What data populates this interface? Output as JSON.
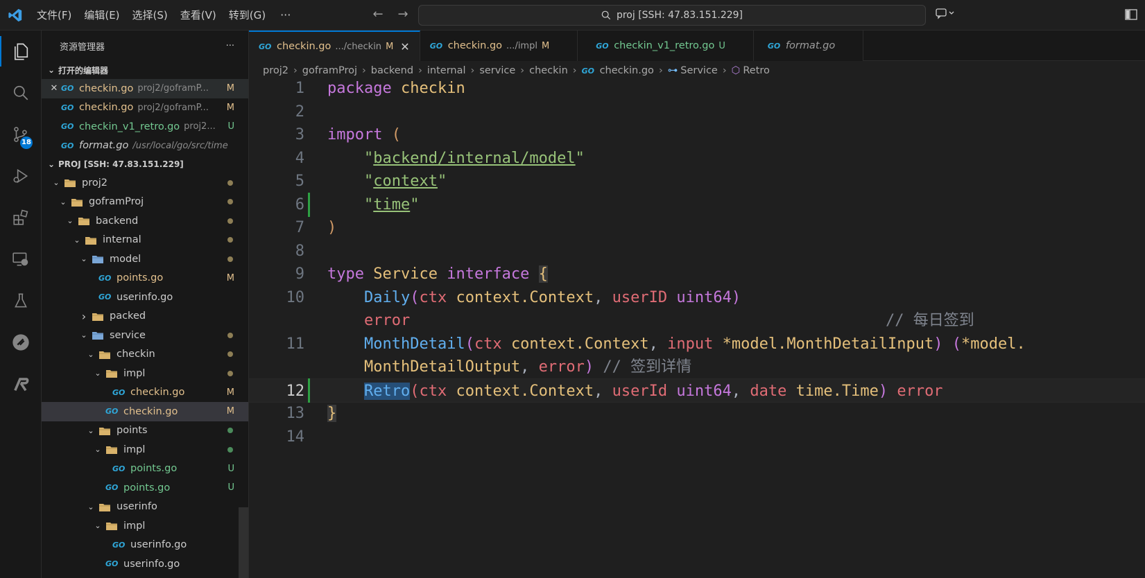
{
  "titlebar": {
    "menu": [
      "文件(F)",
      "编辑(E)",
      "选择(S)",
      "查看(V)",
      "转到(G)"
    ],
    "more": "···",
    "search_text": "proj [SSH: 47.83.151.229]"
  },
  "activity": {
    "scm_badge": "18"
  },
  "sidebar": {
    "title": "资源管理器",
    "more": "···",
    "open_editors_title": "打开的编辑器",
    "open_editors": [
      {
        "close": "✕",
        "name": "checkin.go",
        "desc": "proj2/goframP...",
        "status": "M"
      },
      {
        "name": "checkin.go",
        "desc": "proj2/goframP...",
        "status": "M"
      },
      {
        "name": "checkin_v1_retro.go",
        "desc": "proj2...",
        "status": "U"
      },
      {
        "name": "format.go",
        "desc": "/usr/local/go/src/time",
        "status": ""
      }
    ],
    "project_title": "PROJ [SSH: 47.83.151.229]",
    "tree": [
      {
        "label": "proj2"
      },
      {
        "label": "goframProj"
      },
      {
        "label": "backend"
      },
      {
        "label": "internal"
      },
      {
        "label": "model"
      },
      {
        "label": "points.go",
        "status": "M"
      },
      {
        "label": "userinfo.go"
      },
      {
        "label": "packed"
      },
      {
        "label": "service"
      },
      {
        "label": "checkin"
      },
      {
        "label": "impl"
      },
      {
        "label": "checkin.go",
        "status": "M"
      },
      {
        "label": "checkin.go",
        "status": "M"
      },
      {
        "label": "points"
      },
      {
        "label": "impl"
      },
      {
        "label": "points.go",
        "status": "U"
      },
      {
        "label": "points.go",
        "status": "U"
      },
      {
        "label": "userinfo"
      },
      {
        "label": "impl"
      },
      {
        "label": "userinfo.go"
      },
      {
        "label": "userinfo.go"
      }
    ]
  },
  "tabs": [
    {
      "name": "checkin.go",
      "desc": ".../checkin",
      "status": "M",
      "close": "✕"
    },
    {
      "name": "checkin.go",
      "desc": ".../impl",
      "status": "M"
    },
    {
      "name": "checkin_v1_retro.go",
      "status": "U"
    },
    {
      "name": "format.go"
    }
  ],
  "breadcrumb": [
    "proj2",
    "goframProj",
    "backend",
    "internal",
    "service",
    "checkin",
    "checkin.go",
    "Service",
    "Retro"
  ],
  "editor": {
    "line_numbers": [
      "1",
      "2",
      "3",
      "4",
      "5",
      "6",
      "7",
      "8",
      "9",
      "10",
      "11",
      "12",
      "13",
      "14"
    ],
    "l1": {
      "kw": "package",
      "name": "checkin"
    },
    "l3": {
      "kw": "import",
      "paren": "("
    },
    "l4": {
      "q1": "\"",
      "path": "backend/internal/model",
      "q2": "\""
    },
    "l5": {
      "q1": "\"",
      "path": "context",
      "q2": "\""
    },
    "l6": {
      "q1": "\"",
      "path": "time",
      "q2": "\""
    },
    "l7": {
      "paren": ")"
    },
    "l9": {
      "kw": "type",
      "name": "Service",
      "kw2": "interface",
      "brace": "{"
    },
    "l10": {
      "fn": "Daily",
      "p1": "(",
      "a1": "ctx",
      "t1": "context.Context",
      "c1": ",",
      "a2": "userID",
      "t2": "uint64",
      "p2": ")"
    },
    "l10b": {
      "ret": "error",
      "comment": "// 每日签到"
    },
    "l11": {
      "fn": "MonthDetail",
      "p1": "(",
      "a1": "ctx",
      "t1": "context.Context",
      "c1": ",",
      "a2": "input",
      "t2": "*model.MonthDetailInput",
      "p2": ")",
      "p3": "(",
      "t3": "*model."
    },
    "l11b": {
      "t": "MonthDetailOutput",
      "c": ",",
      "ret": "error",
      "p": ")",
      "comment": "// 签到详情"
    },
    "l12": {
      "fn": "Retro",
      "p1": "(",
      "a1": "ctx",
      "t1": "context.Context",
      "c1": ",",
      "a2": "userId",
      "t2": "uint64",
      "c2": ",",
      "a3": "date",
      "t3": "time.Time",
      "p2": ")",
      "ret": "error"
    },
    "l13": {
      "brace": "}"
    }
  }
}
